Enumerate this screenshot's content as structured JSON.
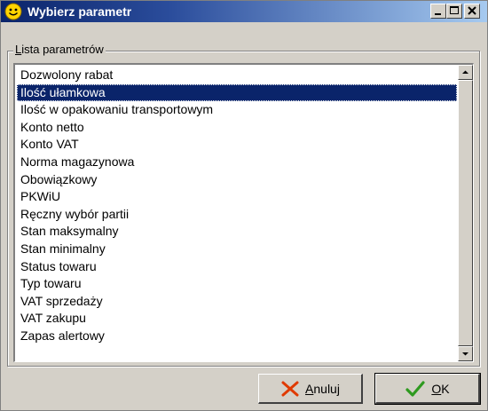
{
  "window": {
    "title": "Wybierz parametr",
    "icon": "smiley-face-icon"
  },
  "titlebar_buttons": [
    "minimize-icon",
    "maximize-icon",
    "close-icon"
  ],
  "group": {
    "label_first": "L",
    "label_rest": "ista parametrów"
  },
  "list": {
    "items": [
      "Dozwolony rabat",
      "Ilość ułamkowa",
      "Ilość w opakowaniu transportowym",
      "Konto netto",
      "Konto VAT",
      "Norma magazynowa",
      "Obowiązkowy",
      "PKWiU",
      "Ręczny wybór partii",
      "Stan maksymalny",
      "Stan minimalny",
      "Status towaru",
      "Typ towaru",
      "VAT sprzedaży",
      "VAT zakupu",
      "Zapas alertowy"
    ],
    "selected_index": 1
  },
  "buttons": {
    "cancel": {
      "first": "A",
      "rest": "nuluj",
      "icon": "red-x-icon",
      "color": "#e03a00"
    },
    "ok": {
      "first": "O",
      "rest": "K",
      "icon": "green-checkmark-icon",
      "color": "#2e9a1f"
    }
  },
  "colors": {
    "titlebar": "#0a246a",
    "selection": "#0a246a",
    "face": "#d4d0c8"
  }
}
